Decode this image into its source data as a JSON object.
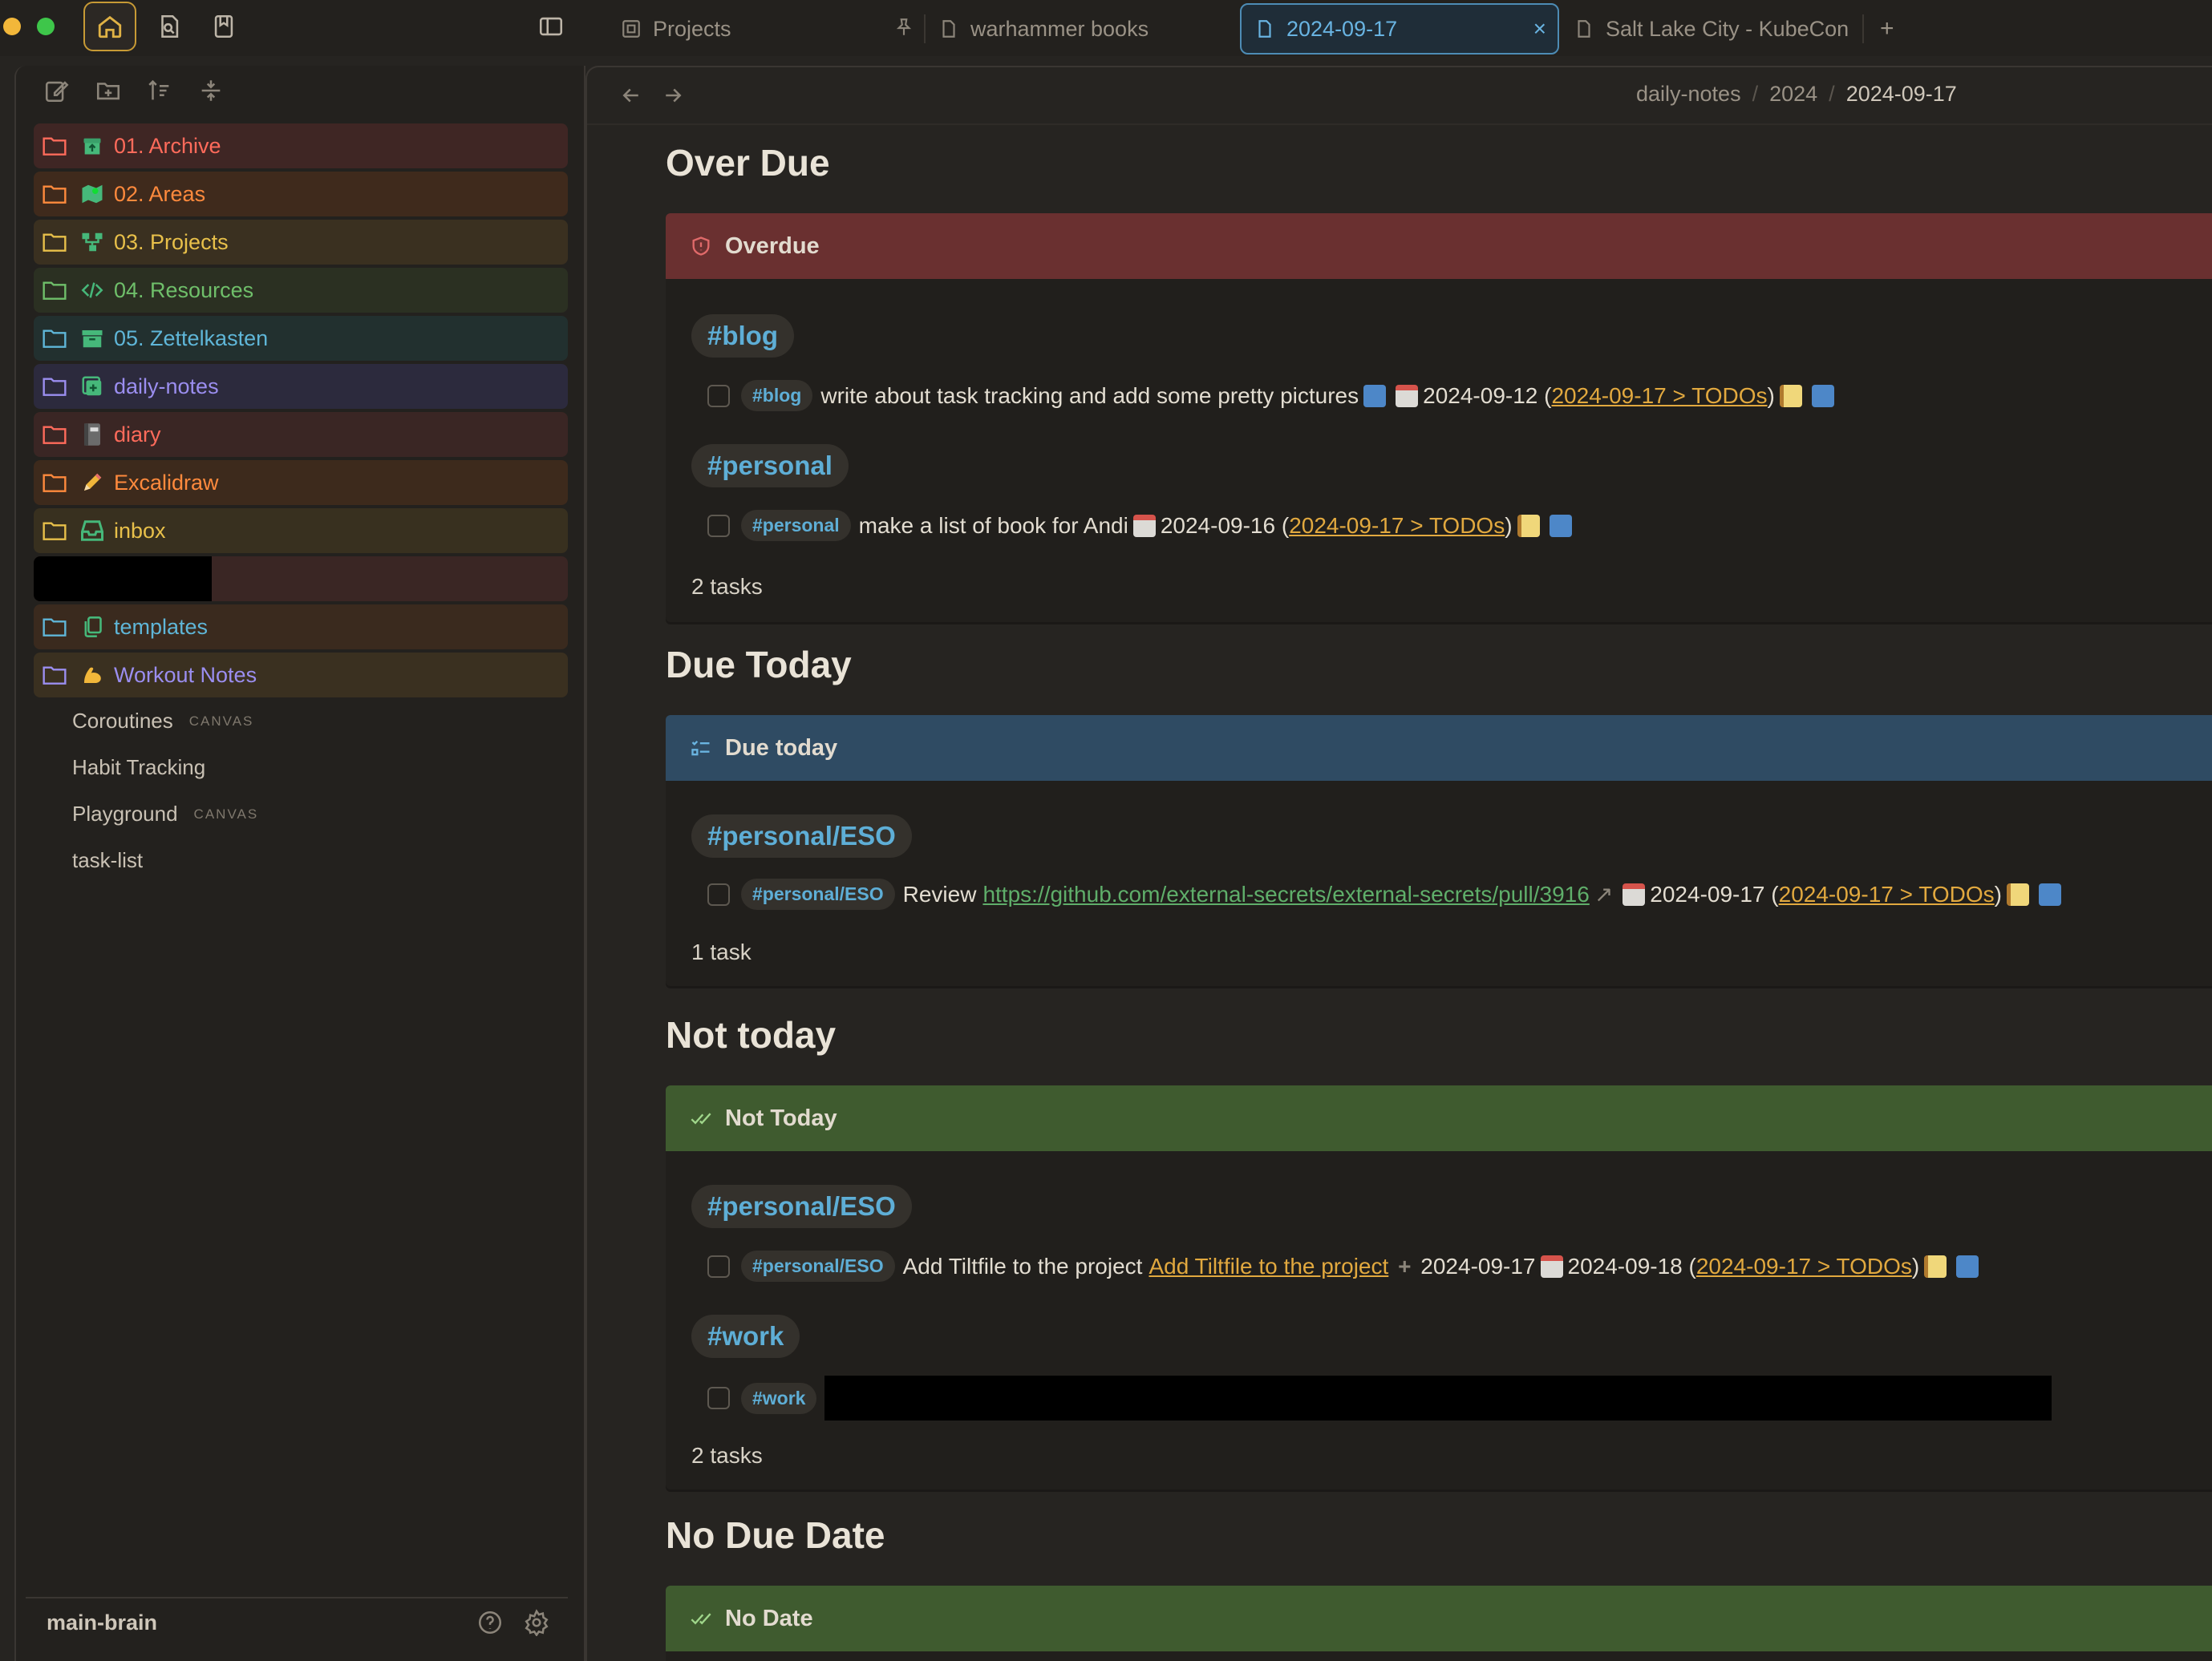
{
  "tabs": [
    {
      "label": "Projects"
    },
    {
      "label": "warhammer books"
    },
    {
      "label": "2024-09-17",
      "close": "×"
    },
    {
      "label": "Salt Lake City - KubeCon"
    }
  ],
  "tab_add": "+",
  "breadcrumb": {
    "a": "daily-notes",
    "b": "2024",
    "c": "2024-09-17",
    "sep": "/"
  },
  "folders": [
    {
      "label": "01. Archive",
      "color": "#ff6b5b",
      "bg": "#3f2624"
    },
    {
      "label": "02. Areas",
      "color": "#ff8a3d",
      "bg": "#3f2a1c"
    },
    {
      "label": "03. Projects",
      "color": "#e8c04a",
      "bg": "#3a3020"
    },
    {
      "label": "04. Resources",
      "color": "#6fbf6a",
      "bg": "#2b3022"
    },
    {
      "label": "05. Zettelkasten",
      "color": "#5fb6d8",
      "bg": "#22302f"
    },
    {
      "label": "daily-notes",
      "color": "#9b8ef0",
      "bg": "#2c2a3d"
    },
    {
      "label": "diary",
      "color": "#ff6b5b",
      "bg": "#3a2624"
    },
    {
      "label": "Excalidraw",
      "color": "#ff8a3d",
      "bg": "#3d2a1c"
    },
    {
      "label": "inbox",
      "color": "#e8c04a",
      "bg": "#38301f"
    },
    {
      "label": "",
      "color": "#b06050",
      "bg": "#3a2624"
    },
    {
      "label": "templates",
      "color": "#5fb6d8",
      "bg": "#3a2a1e"
    },
    {
      "label": "Workout Notes",
      "color": "#9b8ef0",
      "bg": "#3a3020"
    }
  ],
  "files": [
    {
      "label": "Coroutines",
      "tag": "CANVAS"
    },
    {
      "label": "Habit Tracking",
      "tag": ""
    },
    {
      "label": "Playground",
      "tag": "CANVAS"
    },
    {
      "label": "task-list",
      "tag": ""
    }
  ],
  "vault": {
    "name": "main-brain"
  },
  "sections": {
    "overdue": {
      "heading": "Over Due",
      "callout": "Overdue",
      "color": "#6a3030",
      "tag1": "#blog",
      "task1": {
        "pill": "#blog",
        "text": "write about task tracking and add some pretty pictures",
        "date": "2024-09-12 (",
        "link": "2024-09-17 > TODOs",
        "close": ")"
      },
      "tag2": "#personal",
      "task2": {
        "pill": "#personal",
        "text": "make a list of book for Andi",
        "date": "2024-09-16 (",
        "link": "2024-09-17 > TODOs",
        "close": ")"
      },
      "count": "2 tasks"
    },
    "today": {
      "heading": "Due Today",
      "callout": "Due today",
      "color": "#2f4b63",
      "tag1": "#personal/ESO",
      "task1": {
        "pill": "#personal/ESO",
        "text": "Review",
        "url": "https://github.com/external-secrets/external-secrets/pull/3916",
        "arrow": "↗",
        "date": "2024-09-17 (",
        "link": "2024-09-17 > TODOs",
        "close": ")"
      },
      "count": "1 task"
    },
    "nottoday": {
      "heading": "Not today",
      "callout": "Not Today",
      "color": "#3f5b2f",
      "tag1": "#personal/ESO",
      "task1": {
        "pill": "#personal/ESO",
        "text": "Add Tiltfile to the project",
        "link1": "Add Tiltfile to the project",
        "date1": "2024-09-17",
        "date2": "2024-09-18 (",
        "link": "2024-09-17 > TODOs",
        "close": ")"
      },
      "tag2": "#work",
      "task2": {
        "pill": "#work"
      },
      "count": "2 tasks"
    },
    "nodue": {
      "heading": "No Due Date",
      "callout": "No Date",
      "color": "#3f5b2f"
    }
  }
}
